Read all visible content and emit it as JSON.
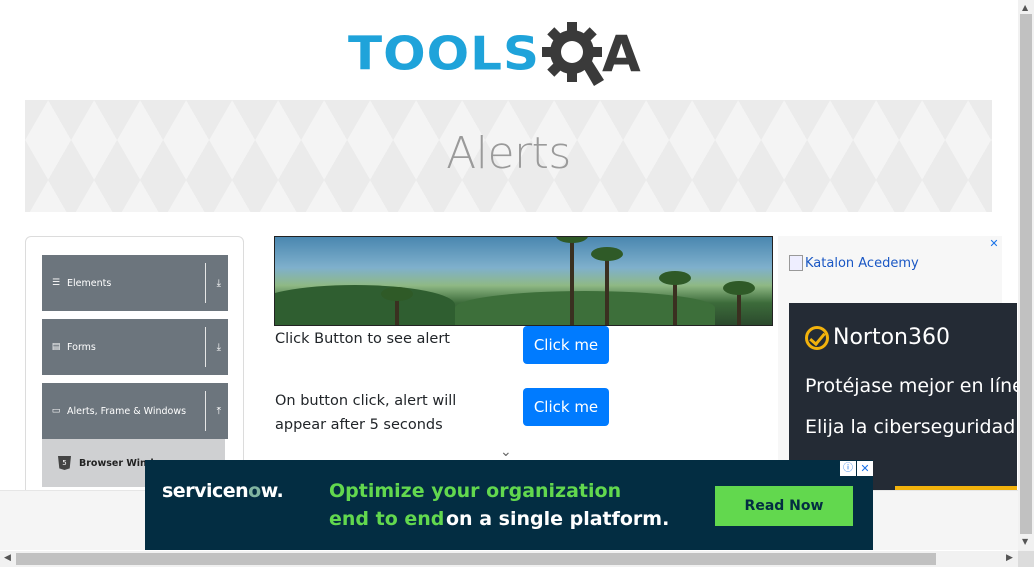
{
  "logo": {
    "part1": "TOOLS",
    "part2": "A",
    "gear_icon": "gear-icon"
  },
  "banner": {
    "title": "Alerts"
  },
  "leftnav": {
    "groups": [
      {
        "label": "Elements",
        "icon": "menu-icon",
        "arrow": "download-icon"
      },
      {
        "label": "Forms",
        "icon": "document-icon",
        "arrow": "download-icon"
      },
      {
        "label": "Alerts, Frame & Windows",
        "icon": "window-icon",
        "arrow": "upload-icon"
      }
    ],
    "subitems": [
      {
        "label": "Browser Windows",
        "icon": "html5-icon"
      }
    ]
  },
  "main": {
    "rows": [
      {
        "text": "Click Button to see alert",
        "button": "Click me"
      },
      {
        "text_line1": "On button click, alert will",
        "text_line2": "appear after 5 seconds",
        "button": "Click me"
      }
    ]
  },
  "ads": {
    "right_close": "✕",
    "katalon_alt": "Katalon Acedemy",
    "norton": {
      "brand": "Norton360",
      "line1": "Protéjase mejor en línea.",
      "line2": "Elija la ciberseguridad."
    },
    "servicenow": {
      "logo_pre": "servicen",
      "logo_o": "o",
      "logo_post": "w.",
      "line1": "Optimize your organization",
      "line2a": "end to end",
      "line2b": "on a single platform.",
      "button": "Read Now",
      "adchoice": "ⓘ",
      "close": "✕"
    }
  },
  "colors": {
    "accent": "#007bff",
    "logo_blue": "#1fa3da",
    "nav_gray": "#6c757d",
    "sn_green": "#62d84e",
    "sn_bg": "#032d42"
  }
}
